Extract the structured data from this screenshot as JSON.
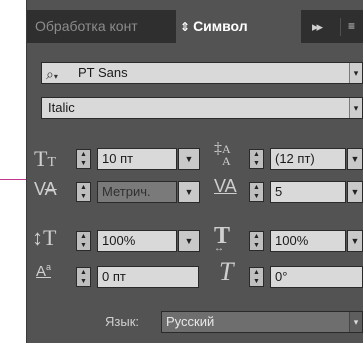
{
  "tabs": [
    {
      "label": "Обработка конт"
    },
    {
      "label": "Символ"
    }
  ],
  "tab_overflow": "▸▸",
  "tab_menu": "≡",
  "font_family": {
    "value": "PT Sans"
  },
  "font_style": {
    "value": "Italic"
  },
  "font_size": {
    "value": "10 пт"
  },
  "leading": {
    "value": "(12 пт)"
  },
  "kerning": {
    "value": "Метрич."
  },
  "tracking": {
    "value": "5"
  },
  "vertical_scale": {
    "value": "100%"
  },
  "horizontal_scale": {
    "value": "100%"
  },
  "baseline_shift": {
    "value": "0 пт"
  },
  "skew": {
    "value": "0°"
  },
  "language": {
    "label": "Язык:",
    "value": "Русский"
  },
  "colors": {
    "panel_bg": "#535353",
    "tabbar_bg": "#2f2f2f",
    "field_bg": "#d9d9d9",
    "guide": "#c2388f"
  }
}
